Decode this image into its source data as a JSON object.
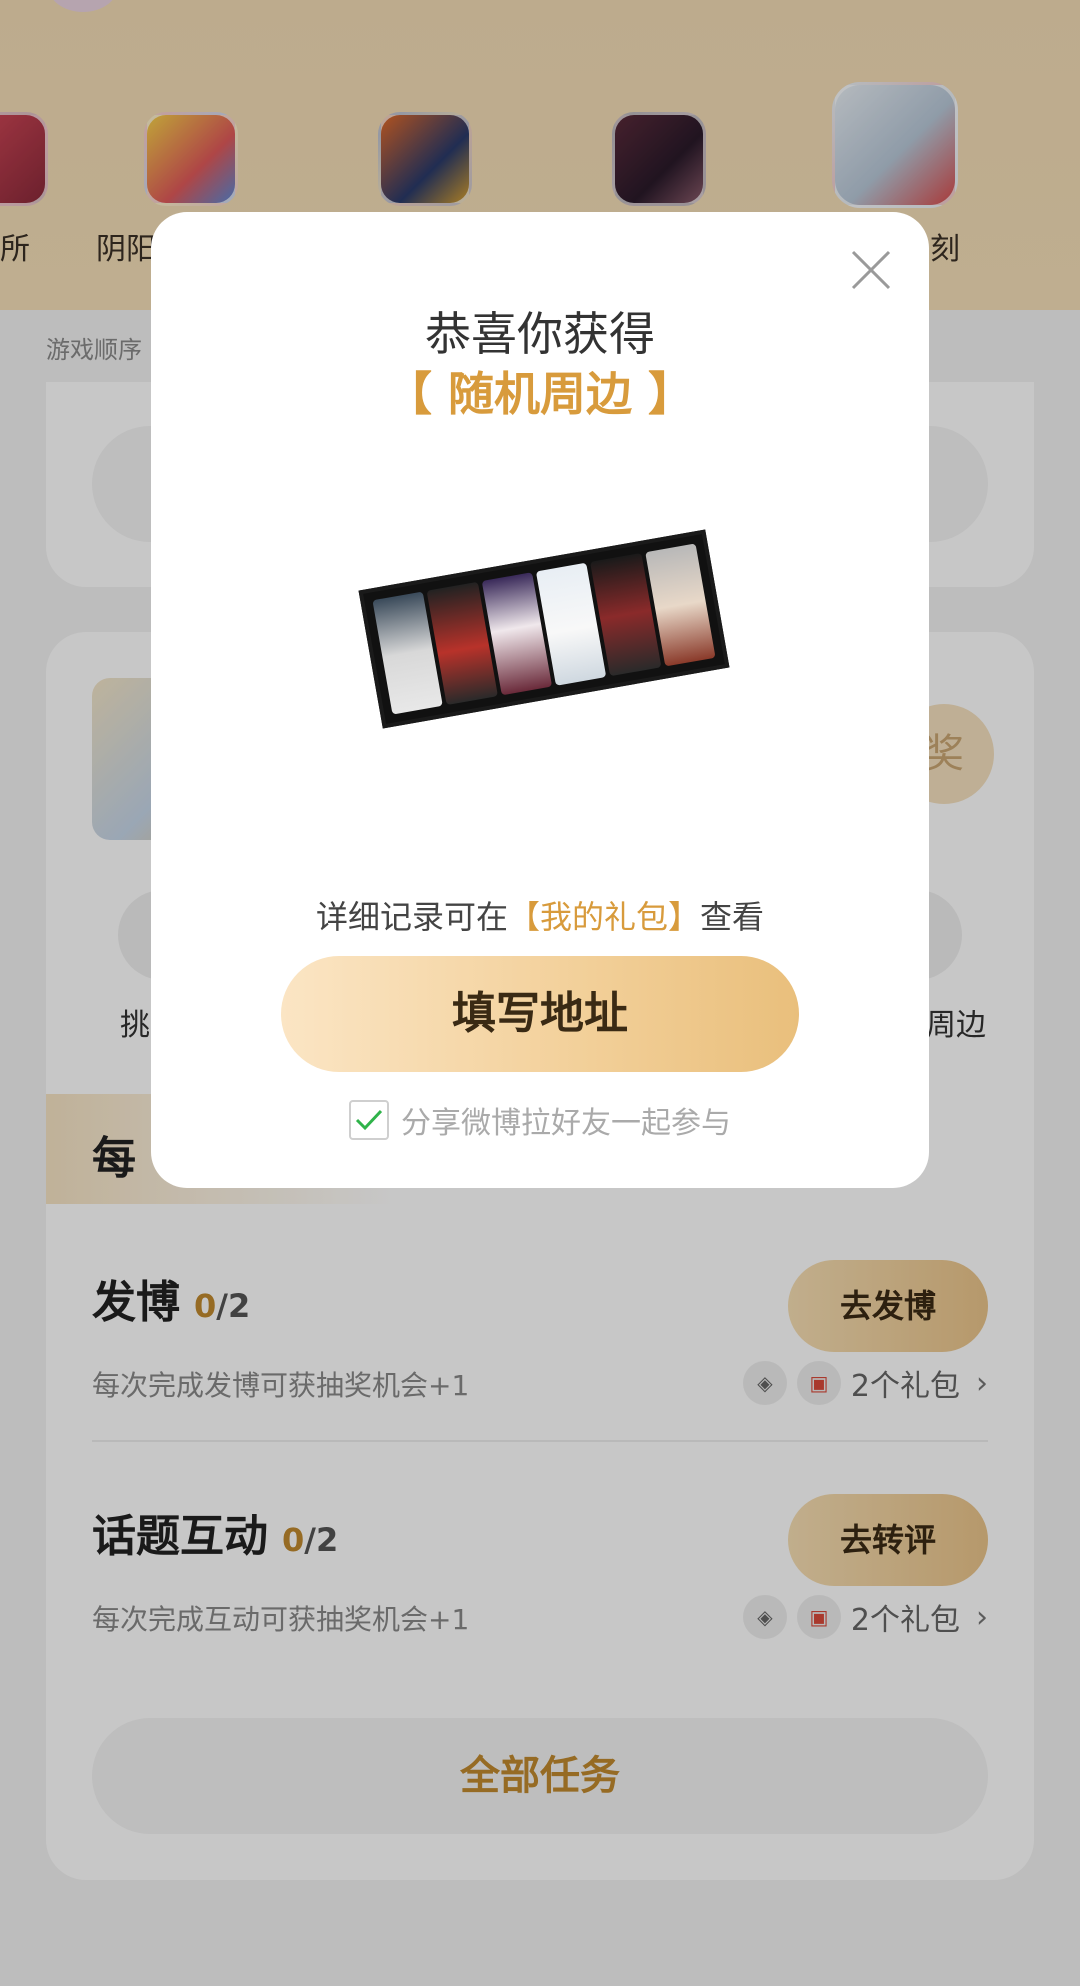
{
  "background": {
    "games": [
      {
        "label": "所"
      },
      {
        "label": "阴阳"
      },
      {
        "label": ""
      },
      {
        "label": ""
      },
      {
        "label": "刻"
      }
    ],
    "sort_hint": "游戏顺序",
    "draw_badge": "奖",
    "entry_labels": [
      "挑",
      "周边"
    ],
    "daily_section_title": "每",
    "tasks": [
      {
        "title": "发博",
        "done": "0",
        "total": "/2",
        "description": "每次完成发博可获抽奖机会+1",
        "button": "去发博",
        "reward": "2个礼包"
      },
      {
        "title": "话题互动",
        "done": "0",
        "total": "/2",
        "description": "每次完成互动可获抽奖机会+1",
        "button": "去转评",
        "reward": "2个礼包"
      }
    ],
    "all_tasks_button": "全部任务"
  },
  "modal": {
    "title": "恭喜你获得",
    "prize_name": "【 随机周边 】",
    "hint_prefix": "详细记录可在",
    "hint_link": "【我的礼包】",
    "hint_suffix": "查看",
    "primary_button": "填写地址",
    "share_checked": true,
    "share_label": "分享微博拉好友一起参与"
  },
  "colors": {
    "accent": "#d89b3c",
    "button_gradient_start": "#fbe5c4",
    "button_gradient_end": "#e9bf7c",
    "check": "#2fb34a"
  }
}
